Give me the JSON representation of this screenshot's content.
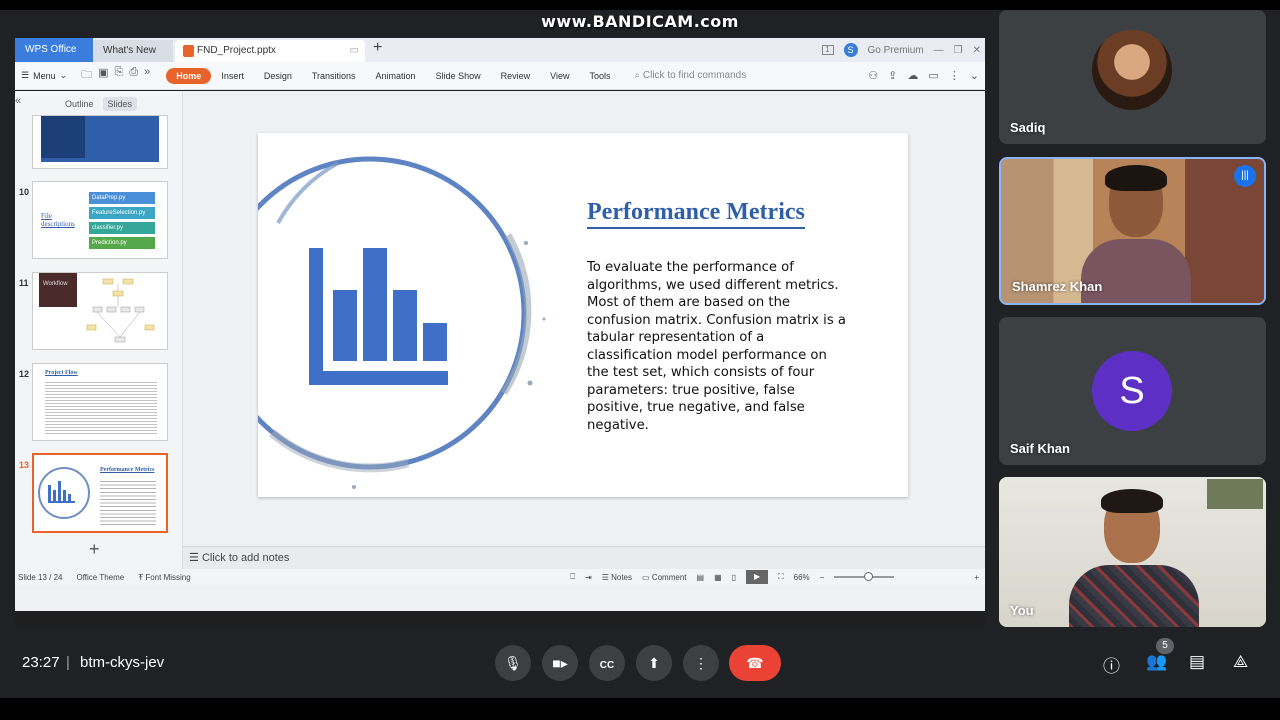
{
  "watermark": "www.BANDICAM.com",
  "app": {
    "tabs": {
      "wps": "WPS Office",
      "whatsnew": "What's New",
      "doc": "FND_Project.pptx"
    },
    "premium": "Go Premium",
    "account_badge": "S",
    "menu_label": "Menu",
    "ribbon": [
      "Home",
      "Insert",
      "Design",
      "Transitions",
      "Animation",
      "Slide Show",
      "Review",
      "View",
      "Tools"
    ],
    "find_placeholder": "Click to find commands",
    "side_tabs": {
      "outline": "Outline",
      "slides": "Slides"
    },
    "thumbs": [
      {
        "num": "10",
        "title": "File descriptions",
        "items": [
          "DataPrep.py",
          "FeatureSelection.py",
          "classifier.py",
          "Prediction.py"
        ]
      },
      {
        "num": "11",
        "title": "Workflow"
      },
      {
        "num": "12",
        "title": "Project Flow"
      },
      {
        "num": "13",
        "title": "Performance Metrics"
      }
    ],
    "slide": {
      "title": "Performance Metrics",
      "body": "To evaluate the performance of algorithms, we used different metrics. Most of them are based on the confusion matrix. Confusion matrix is a tabular representation of a classification model performance on the test set, which consists of four parameters: true positive, false positive, true negative, and false negative."
    },
    "notes_placeholder": "Click to add notes",
    "status": {
      "slide_count": "Slide 13 / 24",
      "theme": "Office Theme",
      "font_missing": "Font Missing",
      "notes": "Notes",
      "comment": "Comment",
      "zoom": "66%"
    }
  },
  "participants": [
    {
      "name": "Sadiq"
    },
    {
      "name": "Shamrez Khan"
    },
    {
      "name": "Saif Khan",
      "initial": "S"
    },
    {
      "name": "You"
    }
  ],
  "meeting": {
    "time": "23:27",
    "code": "btm-ckys-jev",
    "people_count": "5"
  },
  "colors": {
    "accent_orange": "#e8632b",
    "slide_blue": "#2f5fa8",
    "end_call": "#ea4335",
    "avatar_purple": "#5e2fc4"
  }
}
